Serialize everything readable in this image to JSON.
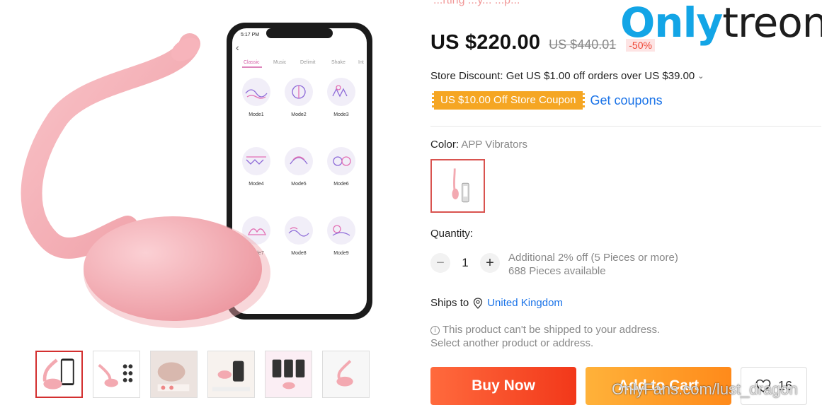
{
  "top_text": "...rting ...y...  ...p...",
  "price": {
    "current": "US $220.00",
    "original": "US $440.01",
    "discount": "-50%"
  },
  "store_discount": {
    "text": "Store Discount: Get US $1.00 off orders over US $39.00",
    "chevron": "chevron-down-icon"
  },
  "coupon": {
    "label": "US $10.00 Off Store Coupon",
    "link": "Get coupons"
  },
  "color": {
    "label": "Color:",
    "value": "APP Vibrators"
  },
  "quantity": {
    "label": "Quantity:",
    "minus": "−",
    "value": "1",
    "plus": "+",
    "additional": "Additional 2% off (5 Pieces or more)",
    "available": "688 Pieces available"
  },
  "shipping": {
    "label": "Ships to",
    "country": "United Kingdom",
    "notice_line1": "This product can't be shipped to your address.",
    "notice_line2": "Select another product or address."
  },
  "actions": {
    "buy_now": "Buy Now",
    "add_to_cart": "Add to Cart",
    "wishlist_count": "16"
  },
  "phone_app": {
    "time": "5:17 PM",
    "tabs": [
      "Classic",
      "Music",
      "Delimit",
      "Shake",
      "Int"
    ],
    "modes": [
      "Mode1",
      "Mode2",
      "Mode3",
      "Mode4",
      "Mode5",
      "Mode6",
      "Mode7",
      "Mode8",
      "Mode9"
    ]
  },
  "watermark": {
    "logo_part1": "Only",
    "logo_part2": "treon",
    "footer": "OnlyFans.com/lust_dragon"
  },
  "colors": {
    "price_red": "#e43e2b",
    "link_blue": "#1a73e8",
    "coupon_orange": "#f5a623",
    "buy_red": "#f2381a",
    "cart_orange": "#ff8a1a",
    "product_pink": "#f5a9b0"
  }
}
